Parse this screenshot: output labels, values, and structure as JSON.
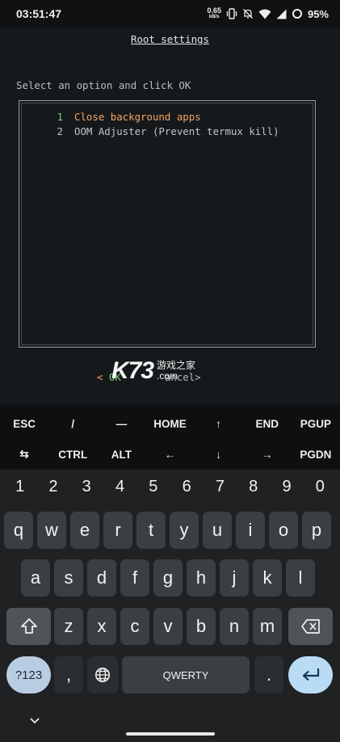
{
  "status_bar": {
    "time": "03:51:47",
    "net_speed": "0.65",
    "net_unit": "kB/s",
    "battery": "95%"
  },
  "terminal": {
    "title": "Root settings",
    "prompt": "Select an option and click OK",
    "menu_items": [
      {
        "num": "1",
        "label": "Close background apps"
      },
      {
        "num": "2",
        "label": "OOM Adjuster (Prevent termux kill)"
      }
    ],
    "ok_prefix": "<",
    "ok_label": "OK",
    "cancel_label": "ancel>"
  },
  "watermark": {
    "logo": "K73",
    "cn": "游戏之家",
    "com": ".com"
  },
  "extra_keys": {
    "row1": [
      "ESC",
      "/",
      "—",
      "HOME",
      "↑",
      "END",
      "PGUP"
    ],
    "row2": [
      "⇆",
      "CTRL",
      "ALT",
      "←",
      "↓",
      "→",
      "PGDN"
    ]
  },
  "keyboard": {
    "numbers": [
      "1",
      "2",
      "3",
      "4",
      "5",
      "6",
      "7",
      "8",
      "9",
      "0"
    ],
    "row1": [
      "q",
      "w",
      "e",
      "r",
      "t",
      "y",
      "u",
      "i",
      "o",
      "p"
    ],
    "row2": [
      "a",
      "s",
      "d",
      "f",
      "g",
      "h",
      "j",
      "k",
      "l"
    ],
    "row3": [
      "z",
      "x",
      "c",
      "v",
      "b",
      "n",
      "m"
    ],
    "symbols_label": "?123",
    "comma": ",",
    "space_label": "QWERTY",
    "period": "."
  },
  "colors": {
    "menu_highlight": "#f2a465",
    "number_highlight": "#7bd37b",
    "enter_key": "#b9dcf4",
    "symbols_key": "#b9cde2"
  }
}
